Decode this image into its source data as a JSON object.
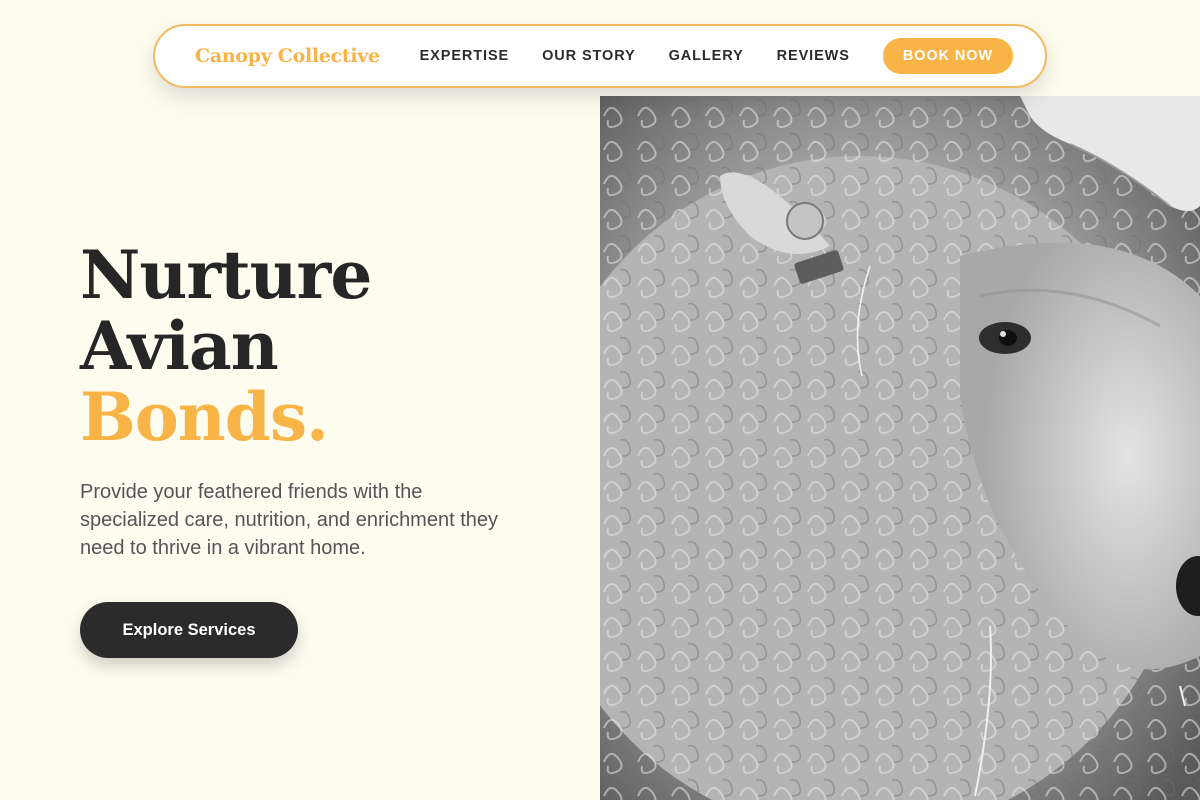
{
  "header": {
    "brand": "Canopy Collective",
    "nav": [
      {
        "label": "EXPERTISE"
      },
      {
        "label": "OUR STORY"
      },
      {
        "label": "GALLERY"
      },
      {
        "label": "REVIEWS"
      }
    ],
    "cta_label": "BOOK NOW"
  },
  "hero": {
    "title_line1": "Nurture",
    "title_line2": "Avian",
    "title_line3": "Bonds.",
    "description": "Provide your feathered friends with the specialized care, nutrition, and enrichment they need to thrive in a vibrant home.",
    "cta_label": "Explore Services",
    "image_alt": "sheep-photo"
  },
  "colors": {
    "background": "#fefcef",
    "accent": "#f9b447",
    "dark": "#2b2b2b"
  }
}
